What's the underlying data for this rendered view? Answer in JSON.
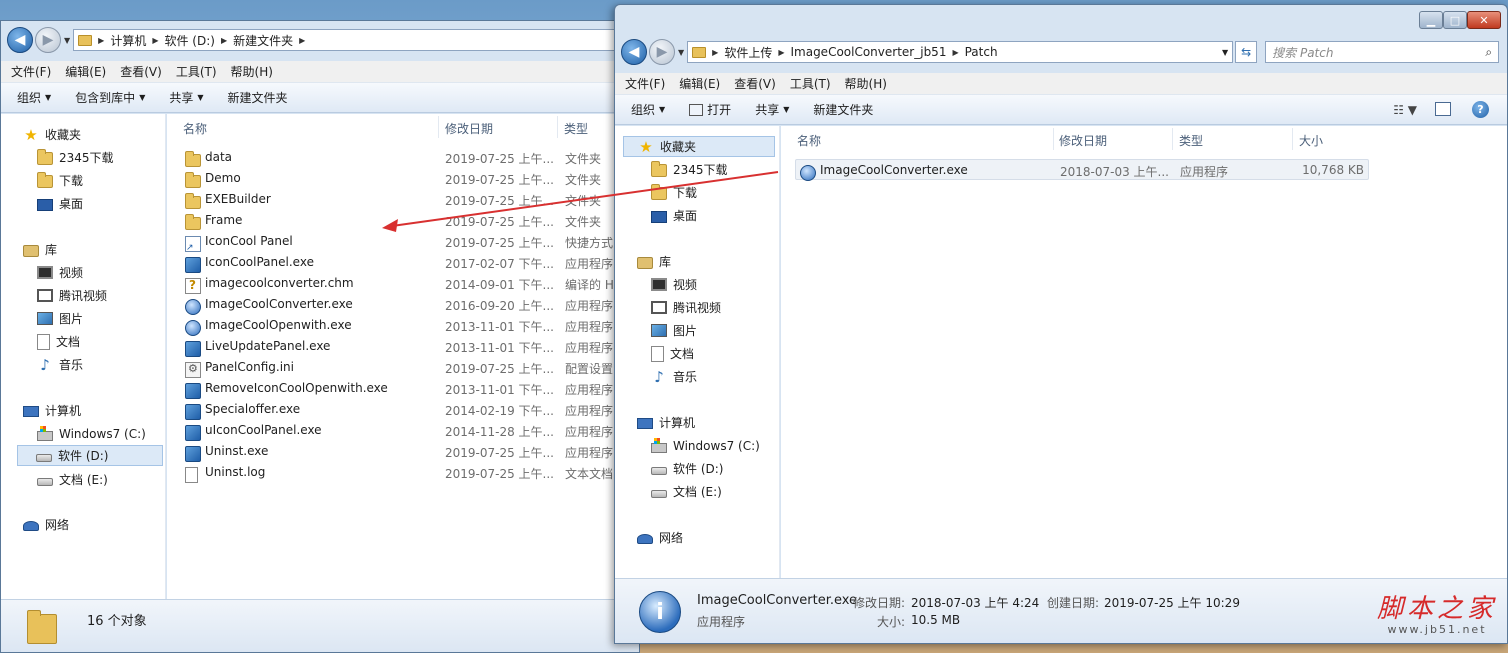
{
  "left_window": {
    "breadcrumb": [
      "计算机",
      "软件 (D:)",
      "新建文件夹"
    ],
    "menu": [
      "文件(F)",
      "编辑(E)",
      "查看(V)",
      "工具(T)",
      "帮助(H)"
    ],
    "toolbar": [
      "组织",
      "包含到库中",
      "共享",
      "新建文件夹"
    ],
    "nav": {
      "favorites": "收藏夹",
      "fav_items": [
        "2345下载",
        "下载",
        "桌面"
      ],
      "library": "库",
      "lib_items": [
        "视频",
        "腾讯视频",
        "图片",
        "文档",
        "音乐"
      ],
      "computer": "计算机",
      "drives": [
        "Windows7 (C:)",
        "软件 (D:)",
        "文档 (E:)"
      ],
      "network": "网络"
    },
    "columns": [
      "名称",
      "修改日期",
      "类型"
    ],
    "files": [
      {
        "name": "data",
        "date": "2019-07-25 上午...",
        "type": "文件夹",
        "icon": "folder-icon"
      },
      {
        "name": "Demo",
        "date": "2019-07-25 上午...",
        "type": "文件夹",
        "icon": "folder-icon"
      },
      {
        "name": "EXEBuilder",
        "date": "2019-07-25 上午...",
        "type": "文件夹",
        "icon": "folder-icon"
      },
      {
        "name": "Frame",
        "date": "2019-07-25 上午...",
        "type": "文件夹",
        "icon": "folder-icon"
      },
      {
        "name": "IconCool Panel",
        "date": "2019-07-25 上午...",
        "type": "快捷方式",
        "icon": "shortcut-icon"
      },
      {
        "name": "IconCoolPanel.exe",
        "date": "2017-02-07 下午...",
        "type": "应用程序",
        "icon": "exe-icon"
      },
      {
        "name": "imagecoolconverter.chm",
        "date": "2014-09-01 下午...",
        "type": "编译的 H",
        "icon": "chm-icon"
      },
      {
        "name": "ImageCoolConverter.exe",
        "date": "2016-09-20 上午...",
        "type": "应用程序",
        "icon": "app-icon"
      },
      {
        "name": "ImageCoolOpenwith.exe",
        "date": "2013-11-01 下午...",
        "type": "应用程序",
        "icon": "app-icon"
      },
      {
        "name": "LiveUpdatePanel.exe",
        "date": "2013-11-01 下午...",
        "type": "应用程序",
        "icon": "exe-icon"
      },
      {
        "name": "PanelConfig.ini",
        "date": "2019-07-25 上午...",
        "type": "配置设置",
        "icon": "ini-icon"
      },
      {
        "name": "RemoveIconCoolOpenwith.exe",
        "date": "2013-11-01 下午...",
        "type": "应用程序",
        "icon": "exe-icon"
      },
      {
        "name": "Specialoffer.exe",
        "date": "2014-02-19 下午...",
        "type": "应用程序",
        "icon": "exe-icon"
      },
      {
        "name": "uIconCoolPanel.exe",
        "date": "2014-11-28 上午...",
        "type": "应用程序",
        "icon": "exe-icon"
      },
      {
        "name": "Uninst.exe",
        "date": "2019-07-25 上午...",
        "type": "应用程序",
        "icon": "exe-icon"
      },
      {
        "name": "Uninst.log",
        "date": "2019-07-25 上午...",
        "type": "文本文档",
        "icon": "txt-icon"
      }
    ],
    "status_count": "16 个对象"
  },
  "right_window": {
    "breadcrumb": [
      "软件上传",
      "ImageCoolConverter_jb51",
      "Patch"
    ],
    "search_placeholder": "搜索 Patch",
    "menu": [
      "文件(F)",
      "编辑(E)",
      "查看(V)",
      "工具(T)",
      "帮助(H)"
    ],
    "toolbar": [
      "组织",
      "打开",
      "共享",
      "新建文件夹"
    ],
    "nav": {
      "favorites": "收藏夹",
      "fav_items": [
        "2345下载",
        "下载",
        "桌面"
      ],
      "library": "库",
      "lib_items": [
        "视频",
        "腾讯视频",
        "图片",
        "文档",
        "音乐"
      ],
      "computer": "计算机",
      "drives": [
        "Windows7 (C:)",
        "软件 (D:)",
        "文档 (E:)"
      ],
      "network": "网络"
    },
    "columns": [
      "名称",
      "修改日期",
      "类型",
      "大小"
    ],
    "files": [
      {
        "name": "ImageCoolConverter.exe",
        "date": "2018-07-03 上午...",
        "type": "应用程序",
        "size": "10,768 KB"
      }
    ],
    "details": {
      "filename": "ImageCoolConverter.exe",
      "filetype": "应用程序",
      "modified_label": "修改日期:",
      "modified_value": "2018-07-03 上午 4:24",
      "created_label": "创建日期:",
      "created_value": "2019-07-25 上午 10:29",
      "size_label": "大小:",
      "size_value": "10.5 MB"
    }
  },
  "watermark": {
    "text": "脚本之家",
    "url": "www.jb51.net"
  },
  "colors": {
    "arrow": "#d83030",
    "watermark": "#d62a2a",
    "selection": "#dce9f7"
  }
}
